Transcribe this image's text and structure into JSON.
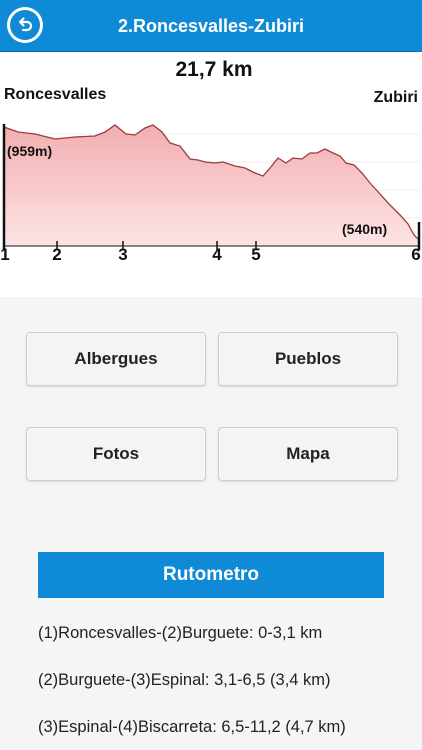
{
  "header": {
    "title": "2.Roncesvalles-Zubiri",
    "back_icon": "back-arrow-icon",
    "color": "#0f8ad6"
  },
  "profile": {
    "distance": "21,7 km",
    "start_name": "Roncesvalles",
    "end_name": "Zubiri",
    "start_altitude": "(959m)",
    "end_altitude": "(540m)",
    "points": [
      "1",
      "2",
      "3",
      "4",
      "5",
      "6"
    ]
  },
  "buttons": {
    "albergues": "Albergues",
    "pueblos": "Pueblos",
    "fotos": "Fotos",
    "mapa": "Mapa"
  },
  "rutometro": {
    "title": "Rutometro",
    "stages": [
      "(1)Roncesvalles-(2)Burguete: 0-3,1 km",
      "(2)Burguete-(3)Espinal: 3,1-6,5 (3,4 km)",
      "(3)Espinal-(4)Biscarreta: 6,5-11,2 (4,7 km)"
    ]
  }
}
